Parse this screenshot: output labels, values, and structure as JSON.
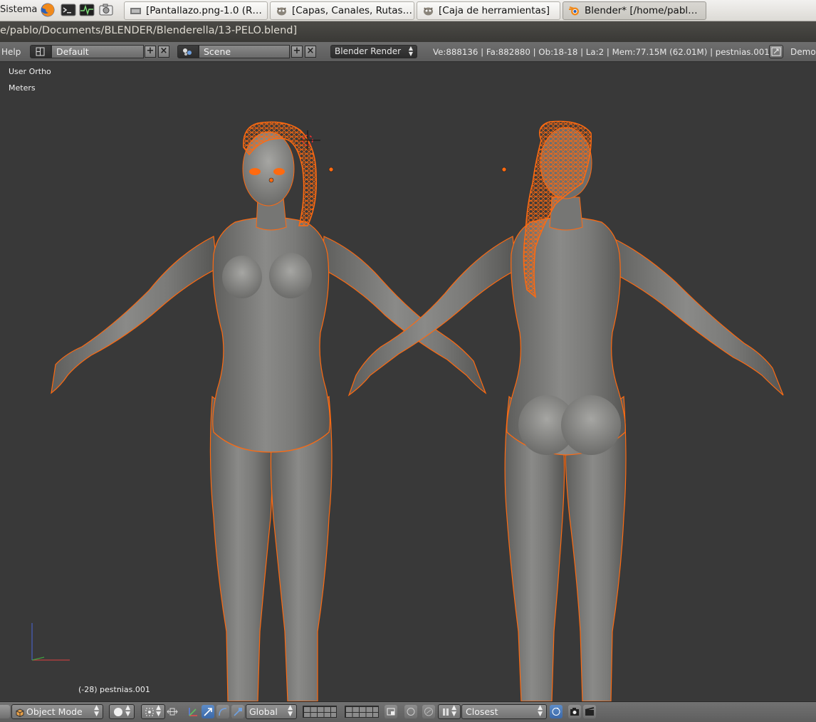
{
  "system_panel": {
    "menu_label": "Sistema",
    "launchers": [
      "firefox-icon",
      "terminal-icon",
      "system-monitor-icon",
      "screenshot-icon"
    ],
    "tasks": [
      {
        "label": "[Pantallazo.png-1.0 (R…",
        "icon": "image-icon",
        "active": false
      },
      {
        "label": "[Capas, Canales, Rutas…",
        "icon": "gimp-icon",
        "active": false
      },
      {
        "label": "[Caja de herramientas]",
        "icon": "gimp-icon",
        "active": false
      },
      {
        "label": "Blender* [/home/pabl…",
        "icon": "blender-icon",
        "active": true
      }
    ]
  },
  "window": {
    "title": "e/pablo/Documents/BLENDER/Blenderella/13-PELO.blend]"
  },
  "info_header": {
    "help_menu": "Help",
    "screen_layout": "Default",
    "scene": "Scene",
    "render_engine": "Blender Render",
    "stats": "Ve:888136 | Fa:882880 | Ob:18-18 | La:2 | Mem:77.15M (62.01M) | pestnias.001",
    "right_label": "Demo"
  },
  "viewport": {
    "view_name": "User Ortho",
    "units": "Meters",
    "object_info": "(-28) pestnias.001",
    "background_color": "#393939",
    "mesh_color": "#7c7c7a",
    "selection_color": "#ff6a10"
  },
  "view_header": {
    "mode": "Object Mode",
    "transform_orientation": "Global",
    "snap_target": "Closest"
  }
}
